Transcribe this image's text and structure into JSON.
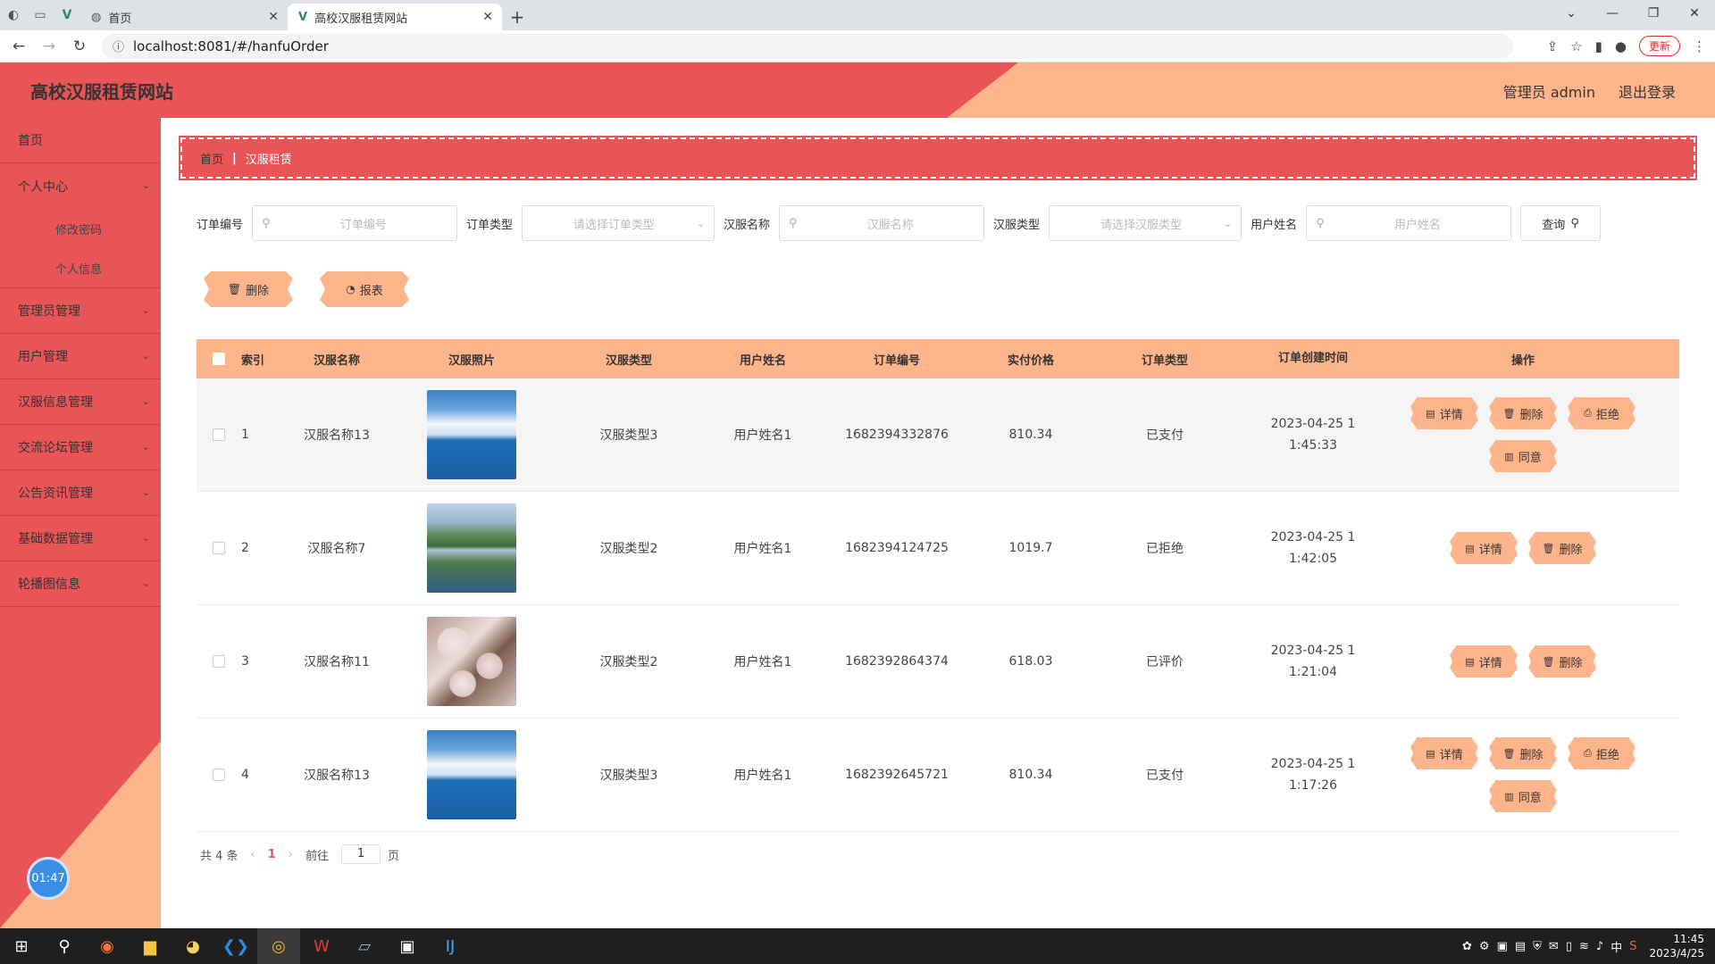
{
  "browser": {
    "tabs": [
      {
        "label": "首页",
        "active": false
      },
      {
        "label": "高校汉服租赁网站",
        "active": true
      }
    ],
    "url": "localhost:8081/#/hanfuOrder",
    "update_label": "更新"
  },
  "header": {
    "brand": "高校汉服租赁网站",
    "admin_label": "管理员 admin",
    "logout_label": "退出登录"
  },
  "sidebar": {
    "items": [
      {
        "label": "首页",
        "expandable": false
      },
      {
        "label": "个人中心",
        "expandable": true,
        "sub": [
          "修改密码",
          "个人信息"
        ]
      },
      {
        "label": "管理员管理",
        "expandable": true
      },
      {
        "label": "用户管理",
        "expandable": true
      },
      {
        "label": "汉服信息管理",
        "expandable": true
      },
      {
        "label": "交流论坛管理",
        "expandable": true
      },
      {
        "label": "公告资讯管理",
        "expandable": true
      },
      {
        "label": "基础数据管理",
        "expandable": true
      },
      {
        "label": "轮播图信息",
        "expandable": true
      }
    ],
    "clock": "01:47"
  },
  "breadcrumb": {
    "home": "首页",
    "current": "汉服租赁"
  },
  "filters": {
    "order_no": {
      "label": "订单编号",
      "placeholder": "订单编号"
    },
    "order_type": {
      "label": "订单类型",
      "placeholder": "请选择订单类型"
    },
    "hanfu_name": {
      "label": "汉服名称",
      "placeholder": "汉服名称"
    },
    "hanfu_type": {
      "label": "汉服类型",
      "placeholder": "请选择汉服类型"
    },
    "user_name": {
      "label": "用户姓名",
      "placeholder": "用户姓名"
    },
    "query_label": "查询"
  },
  "actions": {
    "delete_label": "删除",
    "report_label": "报表"
  },
  "table": {
    "headers": [
      "索引",
      "汉服名称",
      "汉服照片",
      "汉服类型",
      "用户姓名",
      "订单编号",
      "实付价格",
      "订单类型",
      "订单创建时间",
      "操作"
    ],
    "rows": [
      {
        "index": "1",
        "name": "汉服名称13",
        "image": "sky",
        "type": "汉服类型3",
        "user": "用户姓名1",
        "order_no": "1682394332876",
        "price": "810.34",
        "order_type": "已支付",
        "time": "2023-04-25 11:45:33",
        "ops": [
          "详情",
          "删除",
          "拒绝",
          "同意"
        ]
      },
      {
        "index": "2",
        "name": "汉服名称7",
        "image": "karst",
        "type": "汉服类型2",
        "user": "用户姓名1",
        "order_no": "1682394124725",
        "price": "1019.7",
        "order_type": "已拒绝",
        "time": "2023-04-25 11:42:05",
        "ops": [
          "详情",
          "删除"
        ]
      },
      {
        "index": "3",
        "name": "汉服名称11",
        "image": "blossom",
        "type": "汉服类型2",
        "user": "用户姓名1",
        "order_no": "1682392864374",
        "price": "618.03",
        "order_type": "已评价",
        "time": "2023-04-25 11:21:04",
        "ops": [
          "详情",
          "删除"
        ]
      },
      {
        "index": "4",
        "name": "汉服名称13",
        "image": "sky",
        "type": "汉服类型3",
        "user": "用户姓名1",
        "order_no": "1682392645721",
        "price": "810.34",
        "order_type": "已支付",
        "time": "2023-04-25 11:17:26",
        "ops": [
          "详情",
          "删除",
          "拒绝",
          "同意"
        ]
      }
    ]
  },
  "pagination": {
    "total": "共 4 条",
    "current": "1",
    "goto_label": "前往",
    "goto_value": "1",
    "page_suffix": "页"
  },
  "taskbar": {
    "time": "11:45",
    "date": "2023/4/25",
    "ime": "中"
  },
  "colors": {
    "accent_red": "#e95457",
    "accent_peach": "#ffb58c"
  }
}
